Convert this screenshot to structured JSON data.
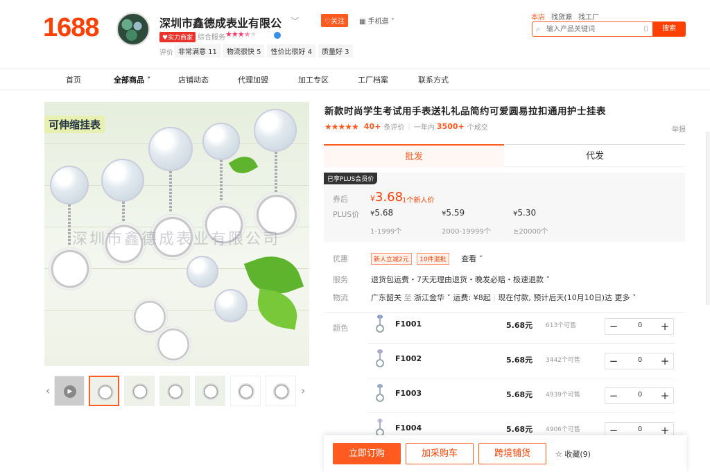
{
  "header": {
    "logo": "1688",
    "shop_name": "深圳市鑫德成表业有限公",
    "follow": "♡关注",
    "mobile": "手机逛",
    "power_badge": "实力商家",
    "service_label": "综合服务",
    "eval_label": "评价",
    "tags": [
      "非常满意 11",
      "物流很快 5",
      "性价比很好 4",
      "质量好 3"
    ],
    "top_links": [
      "本店",
      "找货源",
      "找工厂"
    ],
    "search_placeholder": "输入产品关键词",
    "search_button": "搜索",
    "colors": {
      "brand": "#ff4000",
      "accent": "#ff5a1f"
    }
  },
  "nav": {
    "items": [
      "首页",
      "全部商品",
      "店铺动态",
      "代理加盟",
      "加工专区",
      "工厂档案",
      "联系方式"
    ]
  },
  "gallery": {
    "label": "可伸缩挂表",
    "watermark": "深圳市鑫德成表业有限公司"
  },
  "product": {
    "title": "新款时尚学生考试用手表送礼礼品简约可爱圆易拉扣通用护士挂表",
    "review_count": "40+",
    "review_suffix": "条评价",
    "period": "一年内",
    "sold": "3500+",
    "sold_suffix": "个成交",
    "report": "举报"
  },
  "tabs": [
    "批发",
    "代发"
  ],
  "pricing": {
    "plus_badge": "已享PLUS会员价",
    "coupon_label": "券后",
    "coupon_price": "3.68",
    "currency": "¥",
    "new_user": "1个新人价",
    "plus_label": "PLUS价",
    "tiers": [
      {
        "price": "5.68",
        "qty": "1-1999个"
      },
      {
        "price": "5.59",
        "qty": "2000-19999个"
      },
      {
        "price": "5.30",
        "qty": "≥20000个"
      }
    ]
  },
  "details": {
    "promo_label": "优惠",
    "promo_tags": [
      "新人立减2元",
      "10件混批"
    ],
    "promo_more": "查看",
    "service_label": "服务",
    "service_value": "退货包运费・7天无理由退货・晚发必赔・极速退款",
    "logistics_label": "物流",
    "logistics_from": "广东韶关",
    "logistics_to_word": "至",
    "logistics_to": "浙江金华",
    "logistics_fee": "运费: ¥8起",
    "logistics_eta": "现在付款, 预计后天(10月10日)达",
    "logistics_more": "更多"
  },
  "sku": {
    "label": "颜色",
    "rows": [
      {
        "name": "F1001",
        "price": "5.68元",
        "stock": "613个可售",
        "qty": "0"
      },
      {
        "name": "F1002",
        "price": "5.68元",
        "stock": "3442个可售",
        "qty": "0"
      },
      {
        "name": "F1003",
        "price": "5.68元",
        "stock": "4939个可售",
        "qty": "0"
      },
      {
        "name": "F1004",
        "price": "5.68元",
        "stock": "4906个可售",
        "qty": "0"
      }
    ]
  },
  "actions": {
    "buy": "立即订购",
    "cart": "加采购车",
    "cross_border": "跨境铺货",
    "favorite": "收藏(9)"
  }
}
